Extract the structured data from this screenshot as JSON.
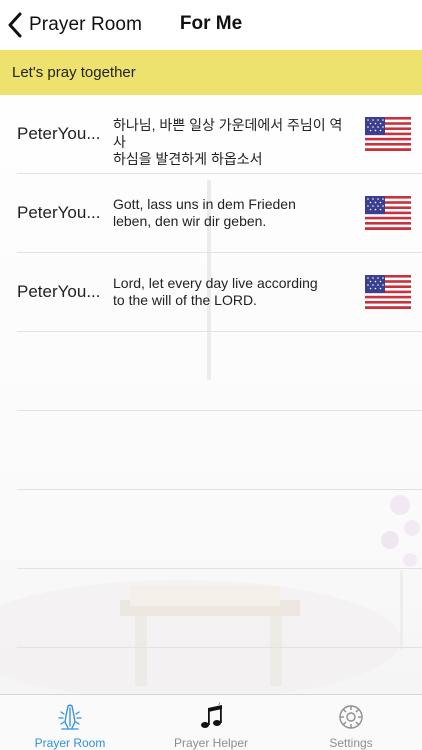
{
  "header": {
    "back_label": "Prayer Room",
    "title": "For Me"
  },
  "banner": {
    "text": "Let's pray together"
  },
  "prayers": [
    {
      "name": "PeterYou...",
      "lines": [
        "하나님, 바쁜 일상 가운데에서 주님이 역사",
        "하심을 발견하게 하옵소서"
      ],
      "flag": "us-flag-icon"
    },
    {
      "name": "PeterYou...",
      "lines": [
        "Gott, lass uns in dem Frieden",
        "leben, den wir dir geben."
      ],
      "flag": "us-flag-icon"
    },
    {
      "name": "PeterYou...",
      "lines": [
        "Lord, let every day live according",
        "to the will of the LORD."
      ],
      "flag": "us-flag-icon"
    }
  ],
  "tabs": [
    {
      "label": "Prayer Room",
      "icon": "praying-hands-icon",
      "active": true
    },
    {
      "label": "Prayer Helper",
      "icon": "music-notes-icon",
      "active": false
    },
    {
      "label": "Settings",
      "icon": "gear-icon",
      "active": false
    }
  ],
  "colors": {
    "banner": "#ede26e",
    "tab_active": "#2f8fe0",
    "tab_inactive": "#8e8e93"
  }
}
